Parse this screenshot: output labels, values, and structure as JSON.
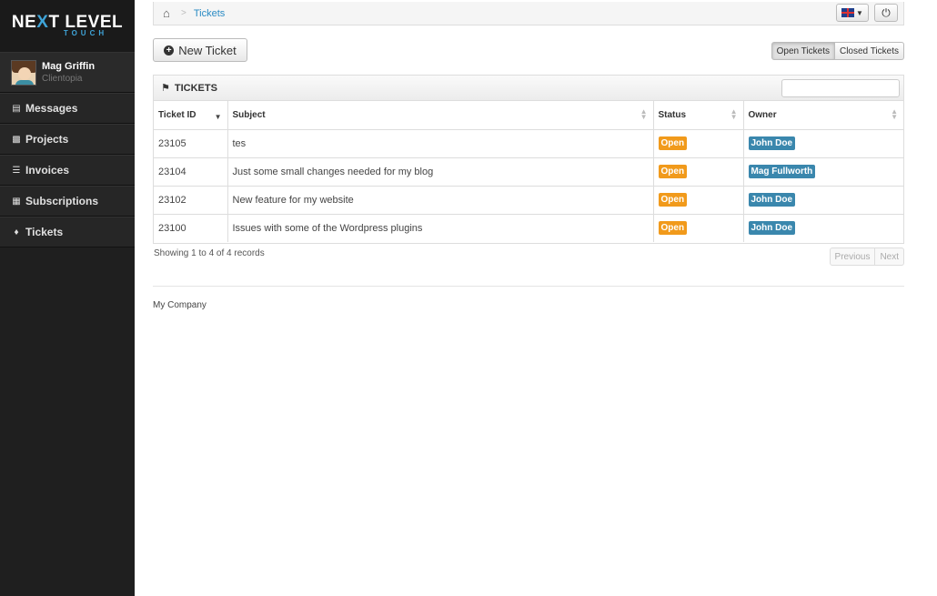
{
  "logo": {
    "main_a": "NE",
    "main_x": "X",
    "main_b": "T LEVEL",
    "sub": "TOUCH"
  },
  "profile": {
    "name": "Mag Griffin",
    "company": "Clientopia"
  },
  "sidebar": {
    "items": [
      {
        "label": "Messages",
        "icon": "inbox-icon"
      },
      {
        "label": "Projects",
        "icon": "briefcase-icon"
      },
      {
        "label": "Invoices",
        "icon": "list-icon"
      },
      {
        "label": "Subscriptions",
        "icon": "calendar-icon"
      },
      {
        "label": "Tickets",
        "icon": "tag-icon"
      }
    ]
  },
  "breadcrumb": {
    "current": "Tickets"
  },
  "toolbar": {
    "new_ticket_label": "New Ticket"
  },
  "tabs": {
    "open": "Open Tickets",
    "closed": "Closed Tickets"
  },
  "panel": {
    "title": "TICKETS",
    "search_placeholder": ""
  },
  "table": {
    "headers": {
      "id": "Ticket ID",
      "subject": "Subject",
      "status": "Status",
      "owner": "Owner"
    },
    "rows": [
      {
        "id": "23105",
        "subject": "tes",
        "status": "Open",
        "owner": "John Doe"
      },
      {
        "id": "23104",
        "subject": "Just some small changes needed for my blog",
        "status": "Open",
        "owner": "Mag Fullworth"
      },
      {
        "id": "23102",
        "subject": "New feature for my website",
        "status": "Open",
        "owner": "John Doe"
      },
      {
        "id": "23100",
        "subject": "Issues with some of the Wordpress plugins",
        "status": "Open",
        "owner": "John Doe"
      }
    ]
  },
  "info": "Showing 1 to 4 of 4 records",
  "pager": {
    "previous": "Previous",
    "next": "Next"
  },
  "footer": "My Company",
  "colors": {
    "accent": "#3fa4d8",
    "open_badge": "#f19a1b",
    "owner_badge": "#3a87ad",
    "link": "#2a8bc4"
  }
}
